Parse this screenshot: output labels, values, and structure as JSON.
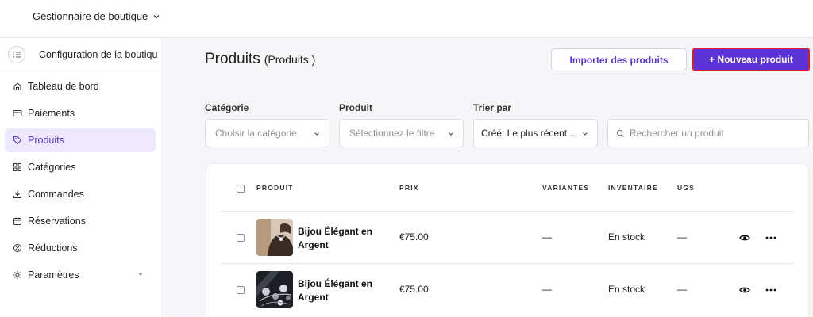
{
  "topbar": {
    "store_name": "Gestionnaire de boutique"
  },
  "sidebar": {
    "config_label": "Configuration de la boutique...",
    "items": [
      {
        "label": "Tableau de bord",
        "icon": "home-icon"
      },
      {
        "label": "Paiements",
        "icon": "card-icon"
      },
      {
        "label": "Produits",
        "icon": "tag-icon",
        "active": true
      },
      {
        "label": "Catégories",
        "icon": "grid-icon"
      },
      {
        "label": "Commandes",
        "icon": "download-icon"
      },
      {
        "label": "Réservations",
        "icon": "calendar-icon"
      },
      {
        "label": "Réductions",
        "icon": "discount-icon"
      },
      {
        "label": "Paramètres",
        "icon": "gear-icon",
        "has_caret": true
      }
    ]
  },
  "page": {
    "title": "Produits",
    "subtitle": "(Produits  )",
    "import_label": "Importer des produits",
    "new_label": "+ Nouveau produit"
  },
  "filters": {
    "category_label": "Catégorie",
    "category_placeholder": "Choisir la catégorie",
    "product_label": "Produit",
    "product_placeholder": "Sélectionnez le filtre",
    "sort_label": "Trier par",
    "sort_value": "Créé:  Le plus récent ...",
    "search_placeholder": "Rechercher un produit"
  },
  "table": {
    "columns": [
      "PRODUIT",
      "PRIX",
      "VARIANTES",
      "INVENTAIRE",
      "UGS"
    ],
    "rows": [
      {
        "name": "Bijou Élégant en Argent",
        "price": "€75.00",
        "variants": "—",
        "inventory": "En stock",
        "sku": "—"
      },
      {
        "name": "Bijou Élégant en Argent",
        "price": "€75.00",
        "variants": "—",
        "inventory": "En stock",
        "sku": "—"
      }
    ]
  },
  "colors": {
    "accent": "#5b33d6",
    "accent_bg": "#ede8fb",
    "highlight_border": "#e0182e"
  }
}
